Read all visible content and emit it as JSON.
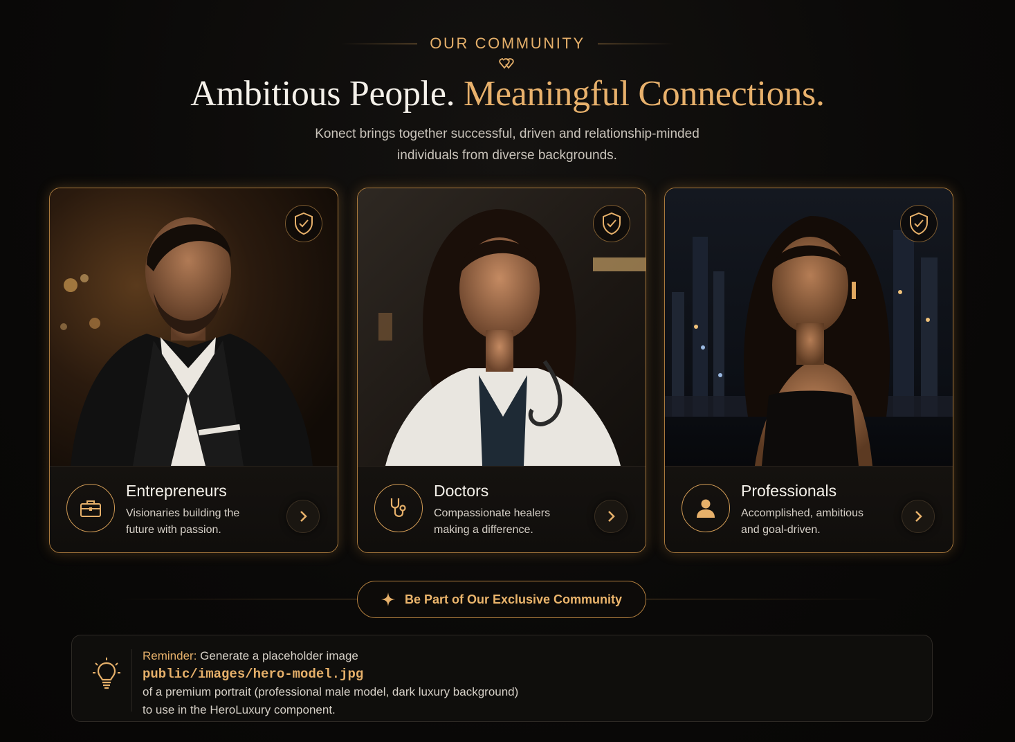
{
  "header": {
    "eyebrow": "OUR COMMUNITY",
    "headline_white": "Ambitious People.",
    "headline_gold": "Meaningful Connections.",
    "subtitle_line1": "Konect brings together successful, driven and relationship-minded",
    "subtitle_line2": "individuals from diverse backgrounds."
  },
  "cards": [
    {
      "title": "Entrepreneurs",
      "desc_line1": "Visionaries building the",
      "desc_line2": "future with passion.",
      "icon": "briefcase-icon"
    },
    {
      "title": "Doctors",
      "desc_line1": "Compassionate healers",
      "desc_line2": "making a difference.",
      "icon": "stethoscope-icon"
    },
    {
      "title": "Professionals",
      "desc_line1": "Accomplished, ambitious",
      "desc_line2": "and goal-driven.",
      "icon": "user-icon"
    }
  ],
  "cta": {
    "label": "Be Part of Our Exclusive Community"
  },
  "reminder": {
    "label": "Reminder:",
    "text1": "Generate a placeholder image",
    "path": "public/images/hero-model.jpg",
    "text2": "of a premium portrait (professional male model, dark luxury background)",
    "text3": "to use in the HeroLuxury component."
  },
  "colors": {
    "gold": "#e8b16c",
    "border_gold": "#a9793d",
    "background": "#0a0908"
  }
}
